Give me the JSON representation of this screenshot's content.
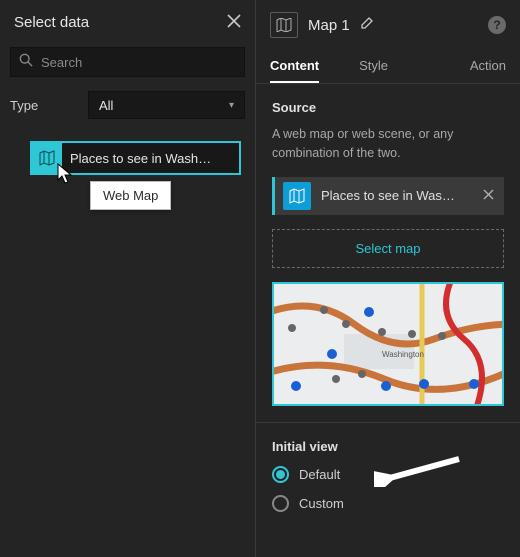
{
  "leftPanel": {
    "title": "Select data",
    "searchPlaceholder": "Search",
    "typeLabel": "Type",
    "typeValue": "All",
    "item": {
      "label": "Places to see in Wash…"
    },
    "tooltip": "Web Map"
  },
  "rightPanel": {
    "title": "Map 1",
    "tabs": {
      "content": "Content",
      "style": "Style",
      "action": "Action"
    },
    "source": {
      "title": "Source",
      "desc": "A web map or web scene, or any combination of the two.",
      "selectedLabel": "Places to see in Was…",
      "selectMapBtn": "Select map"
    },
    "initialView": {
      "title": "Initial view",
      "default": "Default",
      "custom": "Custom"
    }
  }
}
